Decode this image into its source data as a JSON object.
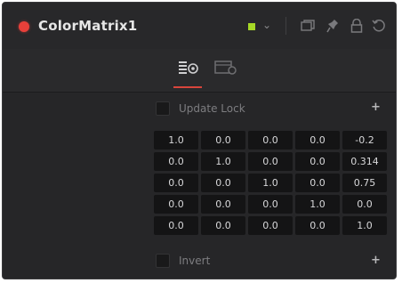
{
  "node": {
    "title": "ColorMatrix1",
    "color_swatch": "#a6d826",
    "status_dot": "#e8403a"
  },
  "header_icons": [
    "chevron-down-icon",
    "versions-icon",
    "pin-icon",
    "lock-icon",
    "reset-icon"
  ],
  "tabs": [
    {
      "name": "controls",
      "active": true
    },
    {
      "name": "settings",
      "active": false
    }
  ],
  "controls": {
    "update_lock_label": "Update Lock",
    "invert_label": "Invert",
    "plus": "+"
  },
  "matrix": [
    [
      "1.0",
      "0.0",
      "0.0",
      "0.0",
      "-0.2"
    ],
    [
      "0.0",
      "1.0",
      "0.0",
      "0.0",
      "0.314"
    ],
    [
      "0.0",
      "0.0",
      "1.0",
      "0.0",
      "0.75"
    ],
    [
      "0.0",
      "0.0",
      "0.0",
      "1.0",
      "0.0"
    ],
    [
      "0.0",
      "0.0",
      "0.0",
      "0.0",
      "1.0"
    ]
  ],
  "accent_color": "#d8453c"
}
